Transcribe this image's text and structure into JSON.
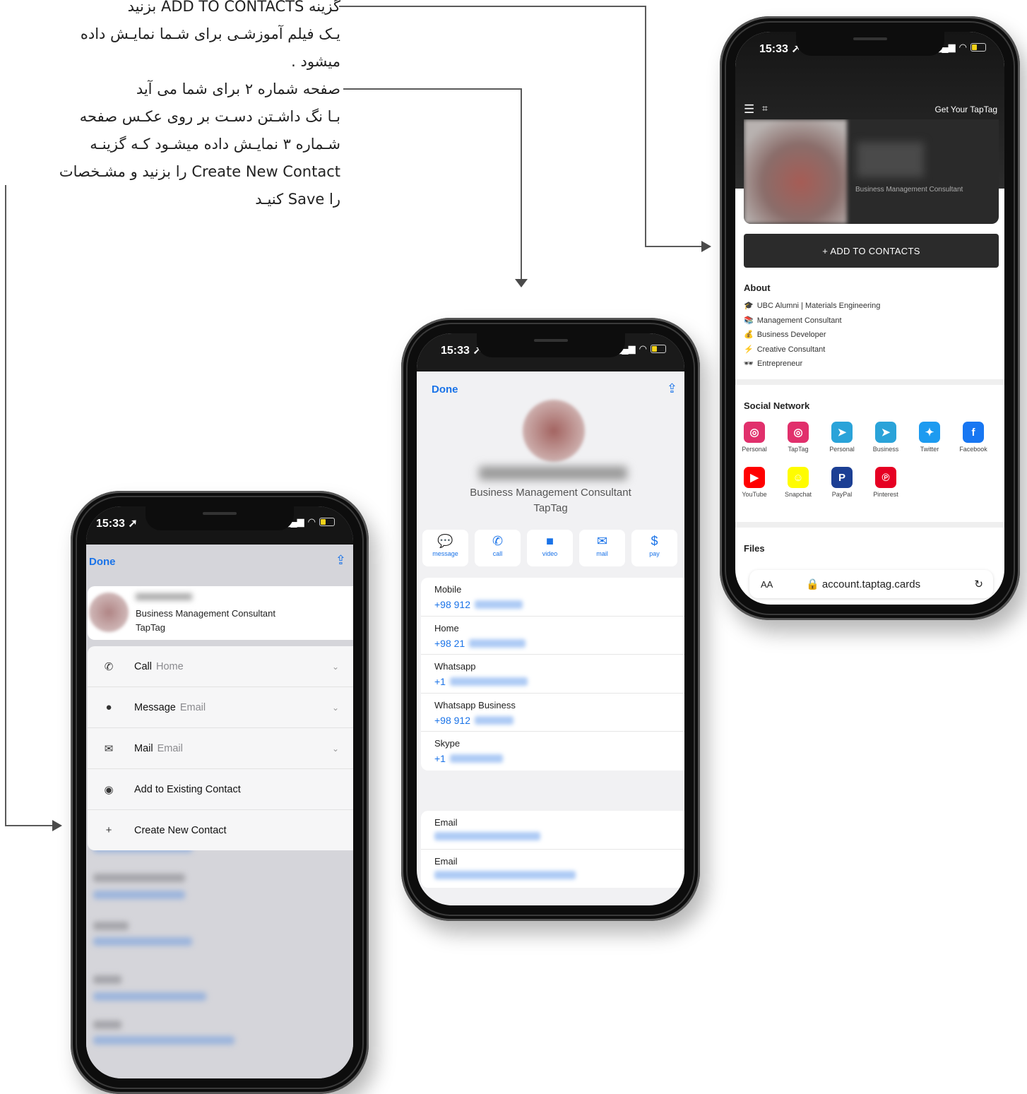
{
  "instructions": {
    "line1": "گزینه ADD TO CONTACTS بزنید",
    "line2": "یـک فیلم آموزشـی برای شـما نمایـش داده",
    "line3": "میشود .",
    "line4": "صفحه شماره ۲ برای شما می آید",
    "line5": "بـا نگ داشـتن دسـت بر روی عکـس صفحه",
    "line6": "شـماره ۳ نمایـش داده میشـود کـه گزینـه",
    "line7": "Create New Contact را بزنید و مشـخصات",
    "line8": "را Save کنیـد"
  },
  "status": {
    "time": "15:33 ➚",
    "signal": "▂▄▆",
    "wifi": "◠"
  },
  "website": {
    "menu_icon": "☰",
    "qr_icon": "⌗",
    "get_button": "Get Your TapTag",
    "job": "Business Management Consultant",
    "add_button": "+ ADD TO CONTACTS",
    "about_title": "About",
    "about": [
      {
        "icon": "🎓",
        "text": "UBC Alumni | Materials Engineering"
      },
      {
        "icon": "📚",
        "text": "Management Consultant"
      },
      {
        "icon": "💰",
        "text": "Business Developer"
      },
      {
        "icon": "⚡",
        "text": "Creative Consultant"
      },
      {
        "icon": "🕶",
        "text": "Entrepreneur"
      }
    ],
    "social_title": "Social Network",
    "social": [
      {
        "label": "Personal",
        "glyph": "◎",
        "color": "#e1306c"
      },
      {
        "label": "TapTag",
        "glyph": "◎",
        "color": "#e1306c"
      },
      {
        "label": "Personal",
        "glyph": "➤",
        "color": "#2aa3d9"
      },
      {
        "label": "Business",
        "glyph": "➤",
        "color": "#2aa3d9"
      },
      {
        "label": "Twitter",
        "glyph": "✦",
        "color": "#1d9bf0"
      },
      {
        "label": "Facebook",
        "glyph": "f",
        "color": "#1877f2"
      },
      {
        "label": "YouTube",
        "glyph": "▶",
        "color": "#ff0000"
      },
      {
        "label": "Snapchat",
        "glyph": "☺",
        "color": "#fffc00"
      },
      {
        "label": "PayPal",
        "glyph": "P",
        "color": "#1c3f94"
      },
      {
        "label": "Pinterest",
        "glyph": "℗",
        "color": "#e60023"
      }
    ],
    "files_title": "Files",
    "url_aa": "AA",
    "url_domain": "🔒 account.taptag.cards",
    "url_reload": "↻",
    "toolbar": [
      ">",
      "⇪",
      "🕮",
      "⧉"
    ]
  },
  "contact": {
    "done": "Done",
    "share": "⇪",
    "job": "Business Management Consultant",
    "org": "TapTag",
    "actions": [
      {
        "icon": "💬",
        "label": "message"
      },
      {
        "icon": "✆",
        "label": "call"
      },
      {
        "icon": "■",
        "label": "video"
      },
      {
        "icon": "✉",
        "label": "mail"
      },
      {
        "icon": "$",
        "label": "pay"
      }
    ],
    "phones": [
      {
        "label": "Mobile",
        "prefix": "+98 912"
      },
      {
        "label": "Home",
        "prefix": "+98 21"
      },
      {
        "label": "Whatsapp",
        "prefix": "+1"
      },
      {
        "label": "Whatsapp Business",
        "prefix": "+98 912"
      },
      {
        "label": "Skype",
        "prefix": "+1"
      }
    ],
    "emails": [
      {
        "label": "Email"
      },
      {
        "label": "Email"
      }
    ]
  },
  "sheet": {
    "done": "Done",
    "share": "⇪",
    "job": "Business Management Consultant",
    "org": "TapTag",
    "items": [
      {
        "icon": "✆",
        "title": "Call",
        "sub": "Home",
        "chevron": "⌄"
      },
      {
        "icon": "●",
        "title": "Message",
        "sub": "Email",
        "chevron": "⌄"
      },
      {
        "icon": "✉",
        "title": "Mail",
        "sub": "Email",
        "chevron": "⌄"
      },
      {
        "icon": "◉",
        "title": "Add to Existing Contact",
        "sub": "",
        "chevron": ""
      },
      {
        "icon": "+",
        "title": "Create New Contact",
        "sub": "",
        "chevron": ""
      }
    ]
  }
}
